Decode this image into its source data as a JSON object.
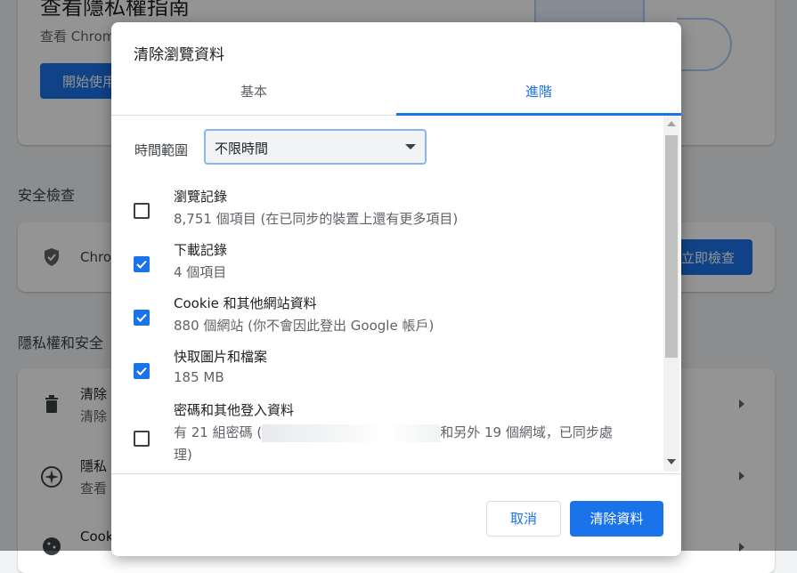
{
  "background": {
    "privacy_guide_title": "查看隱私權指南",
    "privacy_guide_desc": "查看 Chrom",
    "privacy_guide_button": "開始使用",
    "safety_check_heading": "安全檢查",
    "safety_check_text": "Chro",
    "safety_check_button": "立即檢查",
    "privacy_security_heading": "隱私權和安全",
    "items": [
      {
        "title": "清除",
        "subtitle": "清除",
        "icon": "trash-icon"
      },
      {
        "title": "隱私",
        "subtitle": "查看",
        "icon": "compass-icon"
      },
      {
        "title": "Cook",
        "subtitle": "",
        "icon": "cookie-icon"
      }
    ]
  },
  "dialog": {
    "title": "清除瀏覽資料",
    "tabs": [
      {
        "label": "基本",
        "active": false
      },
      {
        "label": "進階",
        "active": true
      }
    ],
    "time_range": {
      "label": "時間範圍",
      "selected": "不限時間"
    },
    "options": [
      {
        "title": "瀏覽記錄",
        "desc": "8,751 個項目 (在已同步的裝置上還有更多項目)",
        "checked": false
      },
      {
        "title": "下載記錄",
        "desc": "4 個項目",
        "checked": true
      },
      {
        "title": "Cookie 和其他網站資料",
        "desc": "880 個網站 (你不會因此登出 Google 帳戶)",
        "checked": true
      },
      {
        "title": "快取圖片和檔案",
        "desc": "185 MB",
        "checked": true
      },
      {
        "title": "密碼和其他登入資料",
        "desc_prefix": "有 21 組密碼 (",
        "desc_suffix": "和另外 19 個網域，已同步處",
        "desc_line2": "理)",
        "checked": false
      }
    ],
    "buttons": {
      "cancel": "取消",
      "clear": "清除資料"
    }
  },
  "colors": {
    "accent": "#1a73e8",
    "text_primary": "#202124",
    "text_secondary": "#5f6368"
  }
}
